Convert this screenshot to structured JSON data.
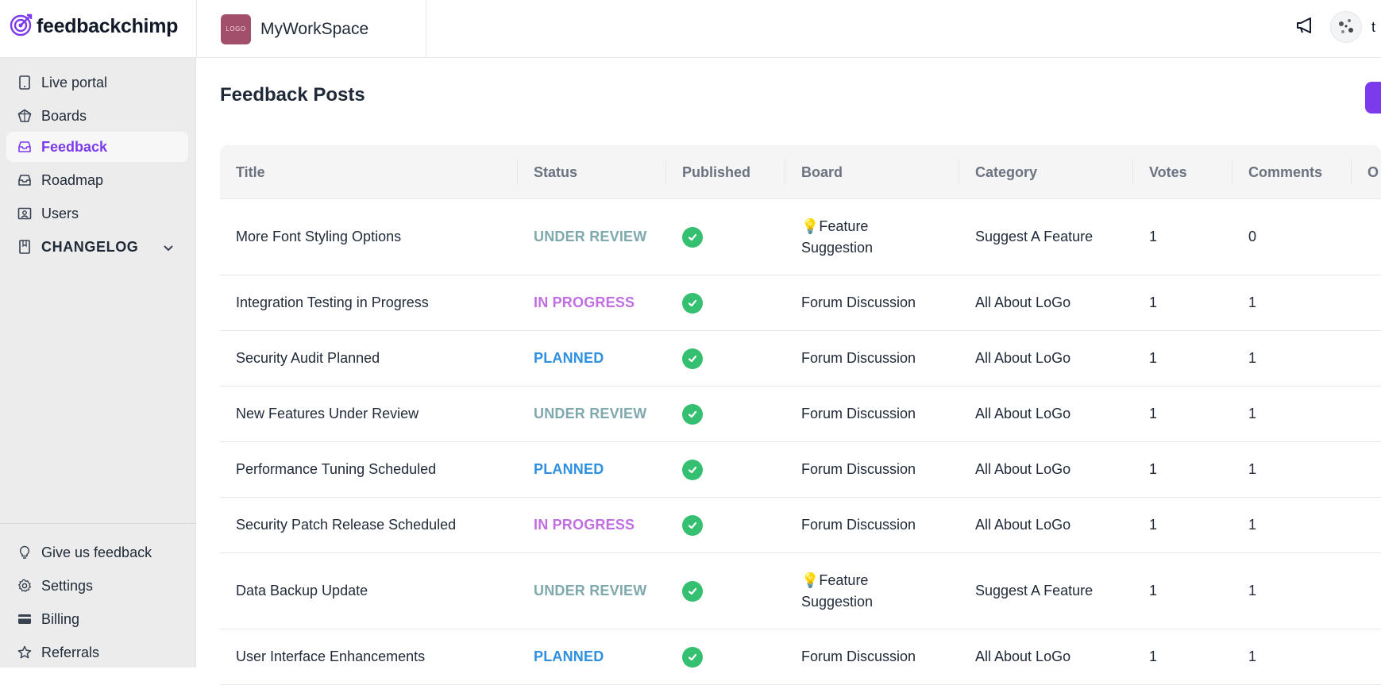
{
  "brand": {
    "name": "feedbackchimp",
    "logo_icon": "target-icon"
  },
  "workspace": {
    "logo_text": "LOGO",
    "name": "MyWorkSpace"
  },
  "header": {
    "announce_icon": "megaphone-icon",
    "user_initial": "t"
  },
  "sidebar": {
    "items": [
      {
        "label": "Live portal",
        "icon": "tablet-icon"
      },
      {
        "label": "Boards",
        "icon": "boards-icon"
      },
      {
        "label": "Feedback",
        "icon": "inbox-icon"
      },
      {
        "label": "Roadmap",
        "icon": "roadmap-icon"
      },
      {
        "label": "Users",
        "icon": "users-icon"
      },
      {
        "label": "CHANGELOG",
        "icon": "book-icon"
      }
    ],
    "bottom_items": [
      {
        "label": "Give us feedback",
        "icon": "lightbulb-icon"
      },
      {
        "label": "Settings",
        "icon": "gear-icon"
      },
      {
        "label": "Billing",
        "icon": "card-icon"
      },
      {
        "label": "Referrals",
        "icon": "star-icon"
      }
    ]
  },
  "main": {
    "title": "Feedback Posts",
    "columns": [
      "Title",
      "Status",
      "Published",
      "Board",
      "Category",
      "Votes",
      "Comments",
      "O"
    ],
    "rows": [
      {
        "title": "More Font Styling Options",
        "status": "UNDER REVIEW",
        "board": "💡Feature Suggestion",
        "category": "Suggest A Feature",
        "votes": "1",
        "comments": "0"
      },
      {
        "title": "Integration Testing in Progress",
        "status": "IN PROGRESS",
        "board": "Forum Discussion",
        "category": "All About LoGo",
        "votes": "1",
        "comments": "1"
      },
      {
        "title": "Security Audit Planned",
        "status": "PLANNED",
        "board": "Forum Discussion",
        "category": "All About LoGo",
        "votes": "1",
        "comments": "1"
      },
      {
        "title": "New Features Under Review",
        "status": "UNDER REVIEW",
        "board": "Forum Discussion",
        "category": "All About LoGo",
        "votes": "1",
        "comments": "1"
      },
      {
        "title": "Performance Tuning Scheduled",
        "status": "PLANNED",
        "board": "Forum Discussion",
        "category": "All About LoGo",
        "votes": "1",
        "comments": "1"
      },
      {
        "title": "Security Patch Release Scheduled",
        "status": "IN PROGRESS",
        "board": "Forum Discussion",
        "category": "All About LoGo",
        "votes": "1",
        "comments": "1"
      },
      {
        "title": "Data Backup Update",
        "status": "UNDER REVIEW",
        "board": "💡Feature Suggestion",
        "category": "Suggest A Feature",
        "votes": "1",
        "comments": "1"
      },
      {
        "title": "User Interface Enhancements",
        "status": "PLANNED",
        "board": "Forum Discussion",
        "category": "All About LoGo",
        "votes": "1",
        "comments": "1"
      }
    ]
  },
  "colors": {
    "accent": "#7c3aed",
    "under_review": "#7fa9ad",
    "in_progress": "#c06ee0",
    "planned": "#2f8fe0",
    "published_check": "#34c070"
  }
}
